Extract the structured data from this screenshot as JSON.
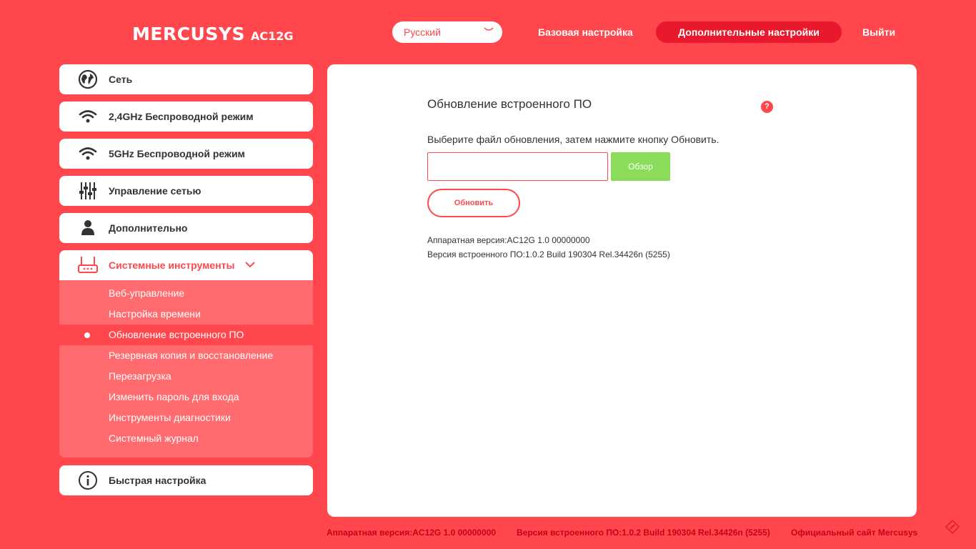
{
  "header": {
    "brand": "MERCUSYS",
    "model": "AC12G",
    "language": "Русский",
    "nav_basic": "Базовая настройка",
    "nav_advanced": "Дополнительные настройки",
    "nav_logout": "Выйти"
  },
  "sidebar": {
    "items": [
      {
        "label": "Сеть",
        "icon": "globe-icon"
      },
      {
        "label": "2,4GHz Беспроводной режим",
        "icon": "wifi-icon"
      },
      {
        "label": "5GHz Беспроводной режим",
        "icon": "wifi-icon"
      },
      {
        "label": "Управление сетью",
        "icon": "sliders-icon"
      },
      {
        "label": "Дополнительно",
        "icon": "user-icon"
      },
      {
        "label": "Системные инструменты",
        "icon": "router-icon"
      },
      {
        "label": "Быстрая настройка",
        "icon": "info-icon"
      }
    ],
    "submenu": [
      "Веб-управление",
      "Настройка времени",
      "Обновление встроенного ПО",
      "Резервная копия и восстановление",
      "Перезагрузка",
      "Изменить пароль для входа",
      "Инструменты диагностики",
      "Системный журнал"
    ]
  },
  "main": {
    "title": "Обновление встроенного ПО",
    "help": "?",
    "instruction": "Выберите файл обновления, затем нажмите кнопку Обновить.",
    "file_value": "",
    "browse_label": "Обзор",
    "update_label": "Обновить",
    "hardware_version": "Аппаратная версия:AC12G 1.0 00000000",
    "firmware_version": "Версия встроенного ПО:1.0.2 Build 190304 Rel.34426n (5255)"
  },
  "footer": {
    "hardware_version": "Аппаратная версия:AC12G 1.0 00000000",
    "firmware_version": "Версия встроенного ПО:1.0.2 Build 190304 Rel.34426n (5255)",
    "site_link": "Официальный сайт Mercusys"
  },
  "colors": {
    "brand_red": "#ff474d",
    "accent_dark_red": "#e8192c",
    "submenu_bg": "#ff6b6f",
    "browse_green": "#8bdc5a"
  }
}
